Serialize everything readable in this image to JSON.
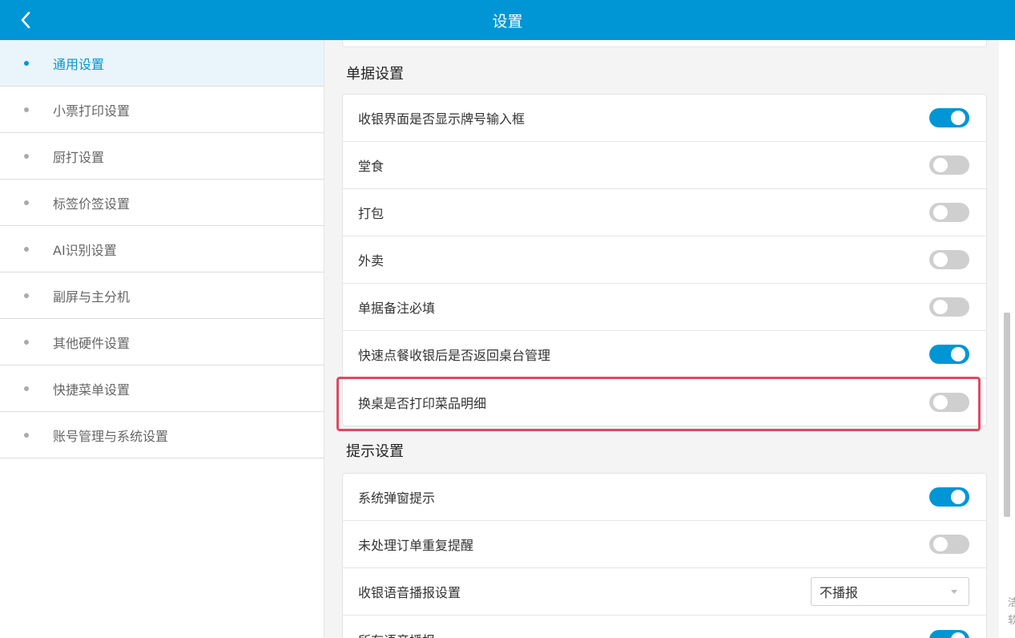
{
  "header": {
    "title": "设置",
    "back_icon": "chevron-left-icon"
  },
  "sidebar": {
    "items": [
      {
        "label": "通用设置",
        "active": true
      },
      {
        "label": "小票打印设置",
        "active": false
      },
      {
        "label": "厨打设置",
        "active": false
      },
      {
        "label": "标签价签设置",
        "active": false
      },
      {
        "label": "AI识别设置",
        "active": false
      },
      {
        "label": "副屏与主分机",
        "active": false
      },
      {
        "label": "其他硬件设置",
        "active": false
      },
      {
        "label": "快捷菜单设置",
        "active": false
      },
      {
        "label": "账号管理与系统设置",
        "active": false
      }
    ]
  },
  "sections": {
    "bill": {
      "title": "单据设置",
      "rows": [
        {
          "label": "收银界面是否显示牌号输入框",
          "enabled": true
        },
        {
          "label": "堂食",
          "enabled": false
        },
        {
          "label": "打包",
          "enabled": false
        },
        {
          "label": "外卖",
          "enabled": false
        },
        {
          "label": "单据备注必填",
          "enabled": false
        },
        {
          "label": "快速点餐收银后是否返回桌台管理",
          "enabled": true
        },
        {
          "label": "换桌是否打印菜品明细",
          "enabled": false,
          "highlighted": true
        }
      ]
    },
    "prompt": {
      "title": "提示设置",
      "rows": [
        {
          "label": "系统弹窗提示",
          "enabled": true
        },
        {
          "label": "未处理订单重复提醒",
          "enabled": false
        },
        {
          "label": "收银语音播报设置",
          "select_value": "不播报"
        },
        {
          "label": "所有语音播报",
          "enabled": true
        }
      ]
    }
  },
  "edge_text": "洁软",
  "colors": {
    "accent": "#0096d6",
    "highlight": "#e2485f",
    "toggle_off": "#cfcfcf"
  }
}
